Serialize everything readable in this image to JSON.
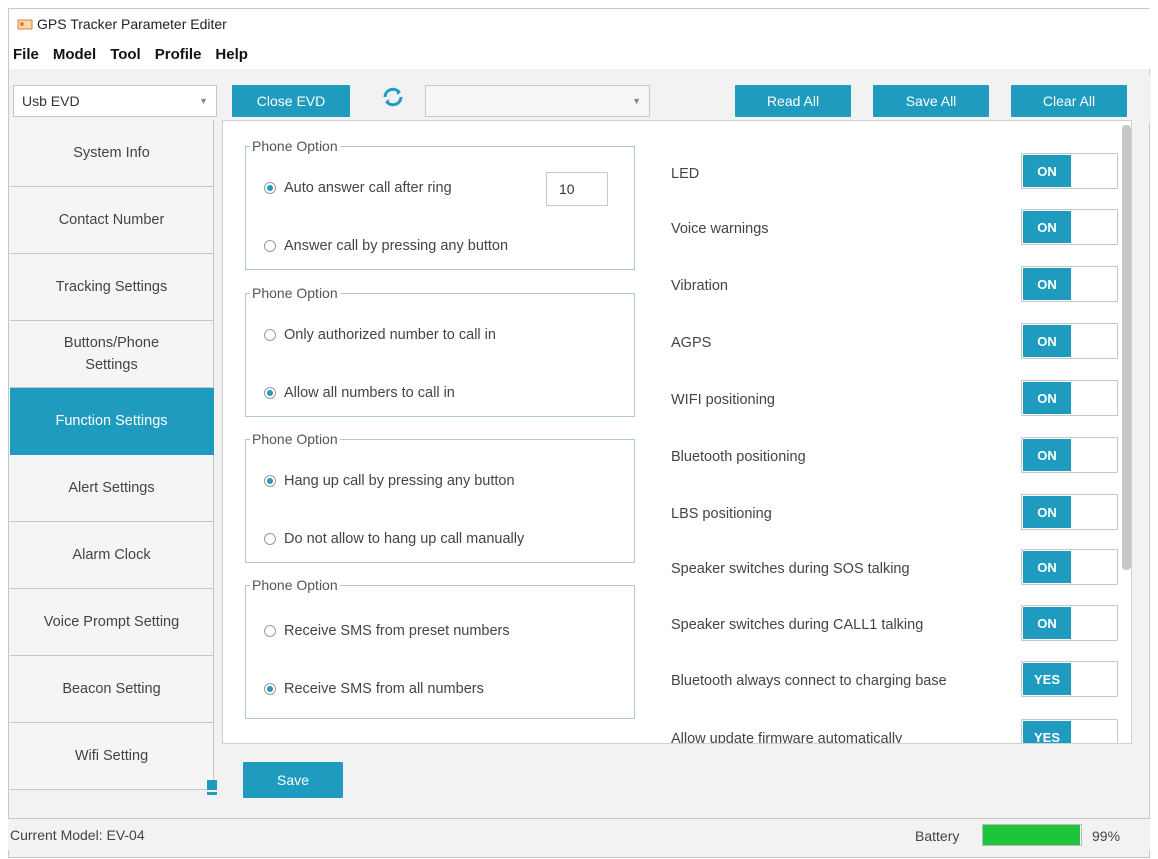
{
  "window": {
    "title": "GPS Tracker Parameter Editer"
  },
  "menu": {
    "items": [
      "File",
      "Model",
      "Tool",
      "Profile",
      "Help"
    ]
  },
  "toolbar": {
    "port_select_value": "Usb EVD",
    "close_button": "Close EVD",
    "device_select_value": "",
    "read_all_button": "Read All",
    "save_all_button": "Save All",
    "clear_all_button": "Clear All"
  },
  "sidebar": {
    "items": [
      {
        "label": "System Info"
      },
      {
        "label": "Contact Number"
      },
      {
        "label": "Tracking Settings"
      },
      {
        "label": "Buttons/Phone Settings"
      },
      {
        "label": "Function Settings",
        "active": true
      },
      {
        "label": "Alert Settings"
      },
      {
        "label": "Alarm Clock"
      },
      {
        "label": "Voice Prompt Setting"
      },
      {
        "label": "Beacon Setting"
      },
      {
        "label": "Wifi Setting"
      }
    ]
  },
  "groups": [
    {
      "legend": "Phone Option",
      "options": [
        {
          "label": "Auto answer call after ring",
          "checked": true
        },
        {
          "label": "Answer call by pressing any button",
          "checked": false
        }
      ],
      "ring_count": "10"
    },
    {
      "legend": "Phone Option",
      "options": [
        {
          "label": "Only authorized number to call in",
          "checked": false
        },
        {
          "label": "Allow all numbers to call in",
          "checked": true
        }
      ]
    },
    {
      "legend": "Phone Option",
      "options": [
        {
          "label": "Hang up call by pressing any button",
          "checked": true
        },
        {
          "label": "Do not allow to hang up call manually",
          "checked": false
        }
      ]
    },
    {
      "legend": "Phone Option",
      "options": [
        {
          "label": "Receive SMS from preset numbers",
          "checked": false
        },
        {
          "label": "Receive SMS from all numbers",
          "checked": true
        }
      ]
    }
  ],
  "toggles": [
    {
      "label": "LED",
      "state": "ON"
    },
    {
      "label": "Voice warnings",
      "state": "ON"
    },
    {
      "label": "Vibration",
      "state": "ON"
    },
    {
      "label": "AGPS",
      "state": "ON"
    },
    {
      "label": "WIFI positioning",
      "state": "ON"
    },
    {
      "label": "Bluetooth positioning",
      "state": "ON"
    },
    {
      "label": "LBS positioning",
      "state": "ON"
    },
    {
      "label": "Speaker switches during SOS talking",
      "state": "ON"
    },
    {
      "label": "Speaker switches during CALL1 talking",
      "state": "ON"
    },
    {
      "label": "Bluetooth always connect to charging base",
      "state": "YES"
    },
    {
      "label": "Allow update firmware automatically",
      "state": "YES"
    }
  ],
  "footer": {
    "save_button": "Save"
  },
  "status": {
    "model": "Current Model: EV-04",
    "battery_label": "Battery",
    "battery_value": "99%",
    "battery_level": 0.99
  },
  "colors": {
    "accent": "#1e9bbf",
    "battery": "#1ec43a"
  }
}
